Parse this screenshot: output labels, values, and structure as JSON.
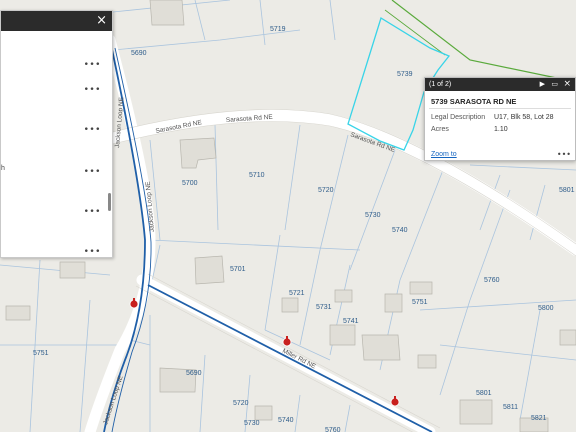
{
  "map": {
    "lot_labels": [
      {
        "text": "5719"
      },
      {
        "text": "5690"
      },
      {
        "text": "5739"
      },
      {
        "text": "5700"
      },
      {
        "text": "5710"
      },
      {
        "text": "5720"
      },
      {
        "text": "5730"
      },
      {
        "text": "5740"
      },
      {
        "text": "5801"
      },
      {
        "text": "5701"
      },
      {
        "text": "5721"
      },
      {
        "text": "5731"
      },
      {
        "text": "5741"
      },
      {
        "text": "5751"
      },
      {
        "text": "5760"
      },
      {
        "text": "5800"
      },
      {
        "text": "5751"
      },
      {
        "text": "5690"
      },
      {
        "text": "5720"
      },
      {
        "text": "5730"
      },
      {
        "text": "5740"
      },
      {
        "text": "5760"
      },
      {
        "text": "5801"
      },
      {
        "text": "5811"
      },
      {
        "text": "5821"
      }
    ],
    "road_labels": {
      "sarasota_left": "Sarasota Rd NE",
      "sarasota_mid": "Sarasota Rd NE",
      "sarasota_right": "Sarasota Rd NE",
      "jackson_upper": "Jackson Loop NE",
      "jackson_mid": "Jackson Loop NE",
      "jackson_lower": "Jackson Loop NE",
      "miller": "Miller Rd NE"
    },
    "colors": {
      "background": "#ecebe6",
      "parcel_line": "#aac4de",
      "road": "#ffffff",
      "selected_parcel": "#38d4e8",
      "utility_line": "#1f5fa8",
      "green_line": "#5aaa3c",
      "hydrant": "#c8201e"
    }
  },
  "layers_panel": {
    "close_icon": "×",
    "more_icon": "•••",
    "left_cut_glyph": "h"
  },
  "popup": {
    "count": "(1 of 2)",
    "next_icon": "▶",
    "maximize_icon": "▭",
    "close_icon": "×",
    "title": "5739 SARASOTA RD NE",
    "attributes": [
      {
        "label": "Legal Description",
        "value": "U17, Blk 58, Lot 28"
      },
      {
        "label": "Acres",
        "value": "1.10"
      }
    ],
    "zoom_link": "Zoom to",
    "more_icon": "•••"
  }
}
